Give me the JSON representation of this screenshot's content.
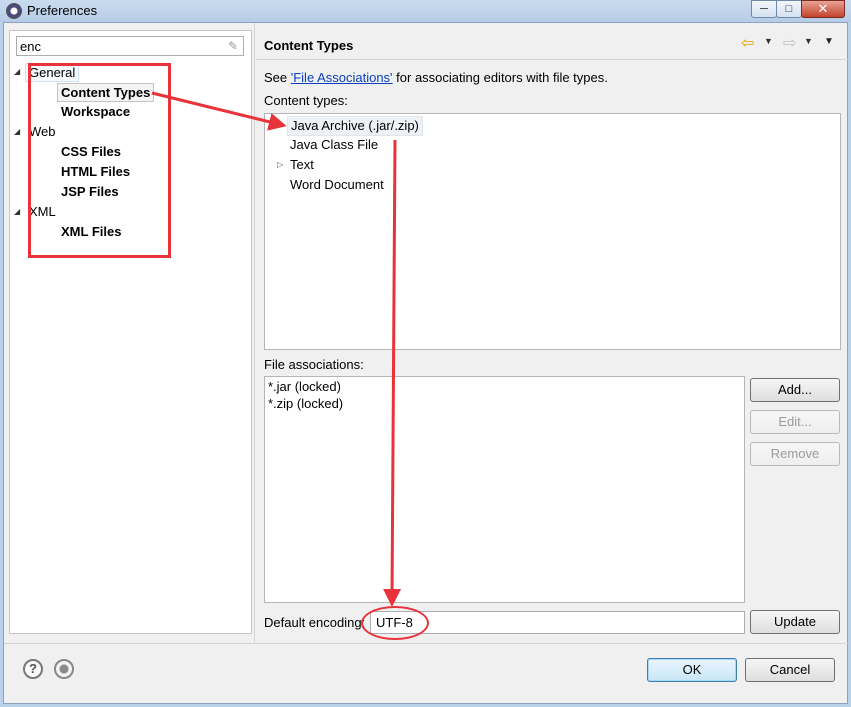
{
  "window": {
    "title": "Preferences",
    "minimize_glyph": "─",
    "maximize_glyph": "□",
    "close_glyph": "✕"
  },
  "filter": {
    "value": "enc",
    "clear_icon": "eraser-icon"
  },
  "tree": {
    "general": "General",
    "content_types": "Content Types",
    "workspace": "Workspace",
    "web": "Web",
    "css_files": "CSS Files",
    "html_files": "HTML Files",
    "jsp_files": "JSP Files",
    "xml": "XML",
    "xml_files": "XML Files"
  },
  "page": {
    "title": "Content Types",
    "desc_pre": "See ",
    "desc_link": "'File Associations'",
    "desc_post": " for associating editors with file types.",
    "content_types_label": "Content types:",
    "content_types": [
      "Java Archive (.jar/.zip)",
      "Java Class File",
      "Text",
      "Word Document"
    ],
    "file_assoc_label": "File associations:",
    "file_associations": [
      "*.jar (locked)",
      "*.zip (locked)"
    ],
    "add_label": "Add...",
    "edit_label": "Edit...",
    "remove_label": "Remove",
    "encoding_label": "Default encoding:",
    "encoding_value": "UTF-8",
    "update_label": "Update"
  },
  "footer": {
    "ok_label": "OK",
    "cancel_label": "Cancel",
    "help_glyph": "?"
  },
  "colors": {
    "annotation": "#e8333a",
    "link": "#0a3fbf",
    "accent": "#3c7fb1"
  }
}
